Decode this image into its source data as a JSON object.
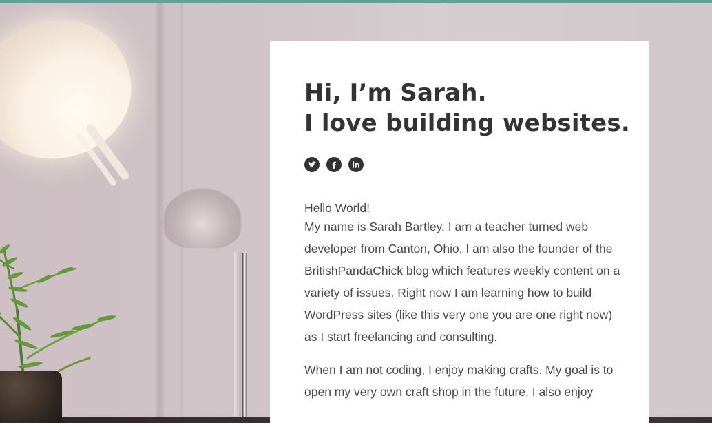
{
  "header": {
    "title_line_1": "Hi, I’m Sarah.",
    "title_line_2": "I love building websites."
  },
  "social": {
    "items": [
      {
        "name": "twitter",
        "icon": "twitter-icon"
      },
      {
        "name": "facebook",
        "icon": "facebook-icon"
      },
      {
        "name": "linkedin",
        "icon": "linkedin-icon"
      }
    ]
  },
  "content": {
    "greeting": "Hello World!",
    "paragraph_1": "My name is Sarah Bartley. I am a teacher turned web developer from Canton, Ohio. I am also the founder of the BritishPandaChick blog which features weekly content on a variety of issues. Right now I am learning how to build WordPress sites (like this very one you are one right now) as I start freelancing and consulting.",
    "paragraph_2": "When I am not coding, I enjoy making crafts. My goal is to open my very own craft shop in the future. I also enjoy"
  },
  "colors": {
    "accent": "#5aa597",
    "text": "#333333",
    "body_text": "#4a4a4a",
    "card_bg": "#ffffff"
  }
}
